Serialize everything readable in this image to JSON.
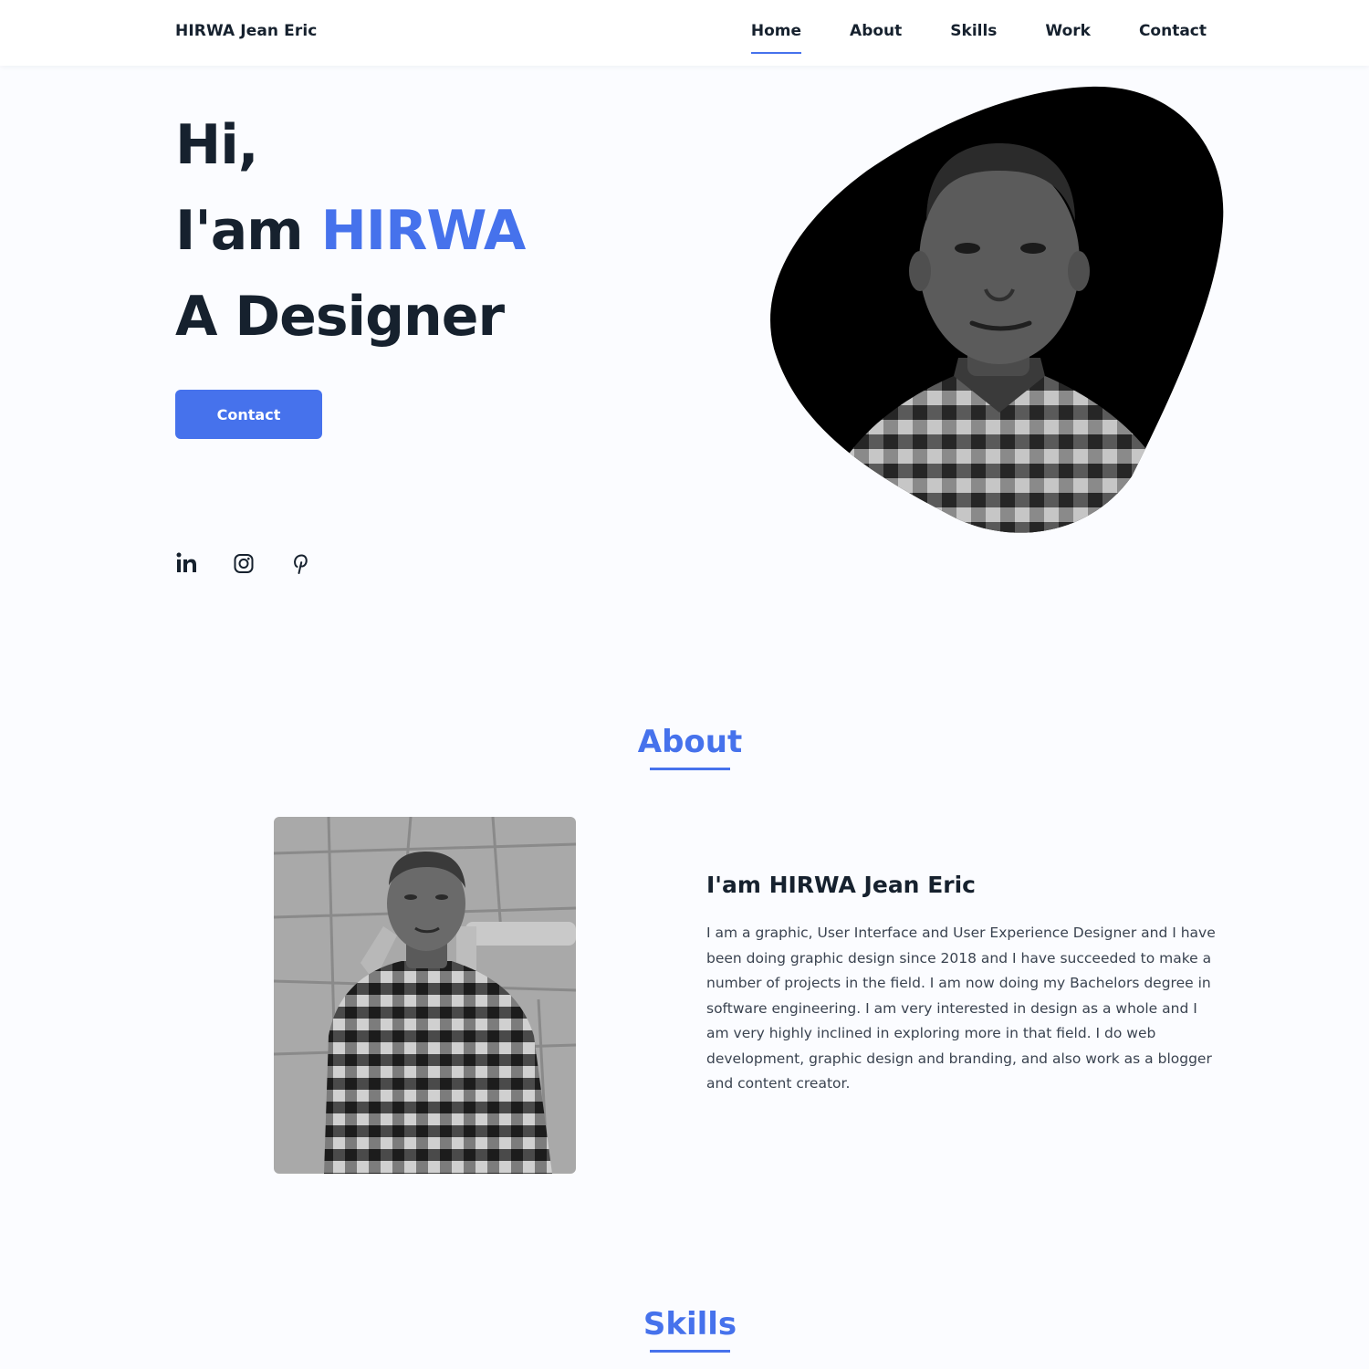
{
  "header": {
    "logo": "HIRWA Jean Eric",
    "nav": [
      {
        "label": "Home",
        "active": true
      },
      {
        "label": "About",
        "active": false
      },
      {
        "label": "Skills",
        "active": false
      },
      {
        "label": "Work",
        "active": false
      },
      {
        "label": "Contact",
        "active": false
      }
    ]
  },
  "hero": {
    "line1": "Hi,",
    "line2_prefix": "I'am ",
    "line2_name": "HIRWA",
    "line3": "A Designer",
    "contact_button": "Contact",
    "social_icons": [
      "linkedin-icon",
      "instagram-icon",
      "pinterest-icon"
    ]
  },
  "about": {
    "title": "About",
    "heading": "I'am HIRWA Jean Eric",
    "text": "I am a graphic, User Interface and User Experience Designer and I have been doing graphic design since 2018 and I have succeeded to make a number of projects in the field. I am now doing my Bachelors degree in software engineering. I am very interested in design as a whole and I am very highly inclined in exploring more in that field. I do web development, graphic design and branding, and also work as a blogger and content creator."
  },
  "skills": {
    "title": "Skills"
  },
  "colors": {
    "accent": "#4672ec",
    "text": "#16212e",
    "background": "#fbfcff"
  }
}
